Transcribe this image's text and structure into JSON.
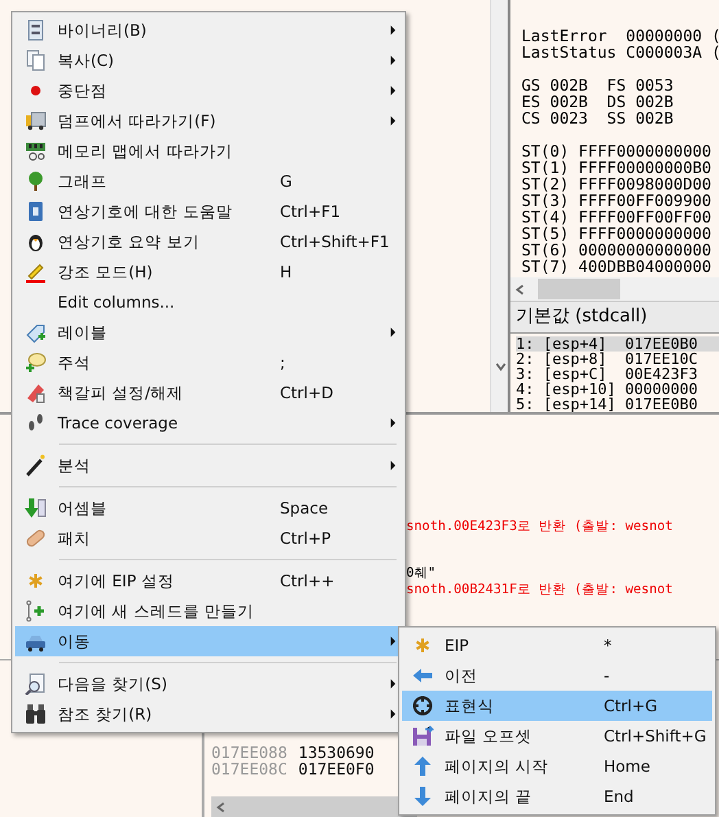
{
  "registers": {
    "groups": [
      [
        "LastError  00000000 (",
        "LastStatus C000003A ("
      ],
      [
        "GS 002B  FS 0053",
        "ES 002B  DS 002B",
        "CS 0023  SS 002B"
      ],
      [
        "ST(0) FFFF0000000000",
        "ST(1) FFFF00000000B0",
        "ST(2) FFFF0098000D00",
        "ST(3) FFFF00FF009900",
        "ST(4) FFFF00FF00FF00",
        "ST(5) FFFF0000000000",
        "ST(6) 00000000000000",
        "ST(7) 400DBB04000000"
      ]
    ]
  },
  "call_stack": {
    "header": "기본값 (stdcall)",
    "rows": [
      {
        "text": "1: [esp+4]  017EE0B0",
        "selected": true
      },
      {
        "text": "2: [esp+8]  017EE10C",
        "selected": false
      },
      {
        "text": "3: [esp+C]  00E423F3",
        "selected": false
      },
      {
        "text": "4: [esp+10] 00000000",
        "selected": false
      },
      {
        "text": "5: [esp+14] 017EE0B0",
        "selected": false
      }
    ]
  },
  "log": [
    {
      "kind": "return",
      "text": "snoth.00E423F3로 반환 (출발: wesnot"
    },
    {
      "kind": "plain",
      "text": "0췌\""
    },
    {
      "kind": "return",
      "text": "snoth.00B2431F로 반환 (출발: wesnot"
    }
  ],
  "dump": [
    {
      "address": "017EE088",
      "value": "13530690"
    },
    {
      "address": "017EE08C",
      "value": "017EE0F0"
    }
  ],
  "context_menu": {
    "items": [
      {
        "kind": "item",
        "label": "바이너리(B)",
        "submenu": true,
        "selected": false
      },
      {
        "kind": "item",
        "label": "복사(C)",
        "submenu": true,
        "selected": false
      },
      {
        "kind": "item",
        "label": "중단점",
        "submenu": true,
        "selected": false
      },
      {
        "kind": "item",
        "label": "덤프에서 따라가기(F)",
        "submenu": true,
        "selected": false
      },
      {
        "kind": "item",
        "label": "메모리 맵에서 따라가기",
        "submenu": false,
        "selected": false
      },
      {
        "kind": "item",
        "label": "그래프",
        "shortcut": "G",
        "submenu": false,
        "selected": false
      },
      {
        "kind": "item",
        "label": "연상기호에 대한 도움말",
        "shortcut": "Ctrl+F1",
        "submenu": false,
        "selected": false
      },
      {
        "kind": "item",
        "label": "연상기호 요약 보기",
        "shortcut": "Ctrl+Shift+F1",
        "submenu": false,
        "selected": false
      },
      {
        "kind": "item",
        "label": "강조 모드(H)",
        "shortcut": "H",
        "submenu": false,
        "selected": false
      },
      {
        "kind": "item",
        "label": "Edit columns...",
        "submenu": false,
        "selected": false
      },
      {
        "kind": "item",
        "label": "레이블",
        "submenu": true,
        "selected": false
      },
      {
        "kind": "item",
        "label": "주석",
        "shortcut": ";",
        "submenu": false,
        "selected": false
      },
      {
        "kind": "item",
        "label": "책갈피 설정/해제",
        "shortcut": "Ctrl+D",
        "submenu": false,
        "selected": false
      },
      {
        "kind": "item",
        "label": "Trace coverage",
        "submenu": true,
        "selected": false
      },
      {
        "kind": "separator"
      },
      {
        "kind": "item",
        "label": "분석",
        "submenu": true,
        "selected": false
      },
      {
        "kind": "separator"
      },
      {
        "kind": "item",
        "label": "어셈블",
        "shortcut": "Space",
        "submenu": false,
        "selected": false
      },
      {
        "kind": "item",
        "label": "패치",
        "shortcut": "Ctrl+P",
        "submenu": false,
        "selected": false
      },
      {
        "kind": "separator"
      },
      {
        "kind": "item",
        "label": "여기에 EIP 설정",
        "shortcut": "Ctrl++",
        "submenu": false,
        "selected": false
      },
      {
        "kind": "item",
        "label": "여기에 새 스레드를 만들기",
        "submenu": false,
        "selected": false
      },
      {
        "kind": "item",
        "label": "이동",
        "submenu": true,
        "selected": true
      },
      {
        "kind": "separator"
      },
      {
        "kind": "item",
        "label": "다음을 찾기(S)",
        "submenu": true,
        "selected": false
      },
      {
        "kind": "item",
        "label": "참조 찾기(R)",
        "submenu": true,
        "selected": false
      }
    ]
  },
  "submenu": {
    "items": [
      {
        "label": "EIP",
        "shortcut": "*",
        "selected": false
      },
      {
        "label": "이전",
        "shortcut": "-",
        "selected": false
      },
      {
        "label": "표현식",
        "shortcut": "Ctrl+G",
        "selected": true
      },
      {
        "label": "파일 오프셋",
        "shortcut": "Ctrl+Shift+G",
        "selected": false
      },
      {
        "label": "페이지의 시작",
        "shortcut": "Home",
        "selected": false
      },
      {
        "label": "페이지의 끝",
        "shortcut": "End",
        "selected": false
      }
    ]
  }
}
